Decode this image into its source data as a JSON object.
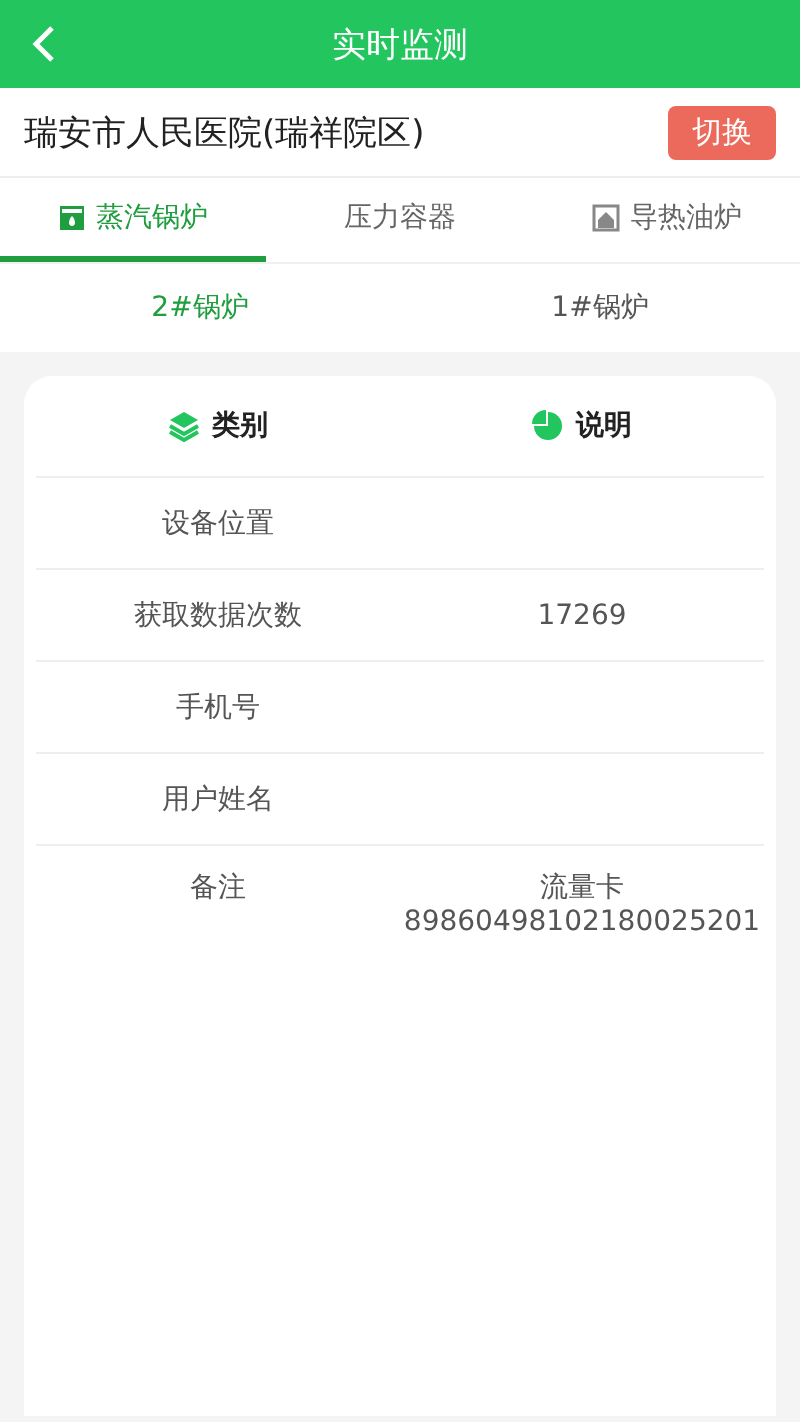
{
  "header": {
    "title": "实时监测"
  },
  "organization": {
    "name": "瑞安市人民医院(瑞祥院区)",
    "switch_button": "切换"
  },
  "tabs": [
    {
      "label": "蒸汽锅炉",
      "kind": "boiler",
      "selected": true
    },
    {
      "label": "压力容器",
      "kind": "plain",
      "selected": false
    },
    {
      "label": "导热油炉",
      "kind": "furnace",
      "selected": false
    }
  ],
  "sub_tabs": [
    {
      "label": "2#锅炉",
      "selected": true
    },
    {
      "label": "1#锅炉",
      "selected": false
    }
  ],
  "table": {
    "columns": [
      {
        "label": "类别",
        "kind": "layers"
      },
      {
        "label": "说明",
        "kind": "pie"
      }
    ],
    "rows": [
      {
        "label": "设备位置"
      },
      {
        "label": "获取数据次数",
        "value": "17269"
      },
      {
        "label": "手机号"
      },
      {
        "label": "用户姓名"
      },
      {
        "label": "备注",
        "value": "流量卡 89860498102180025201"
      }
    ]
  }
}
